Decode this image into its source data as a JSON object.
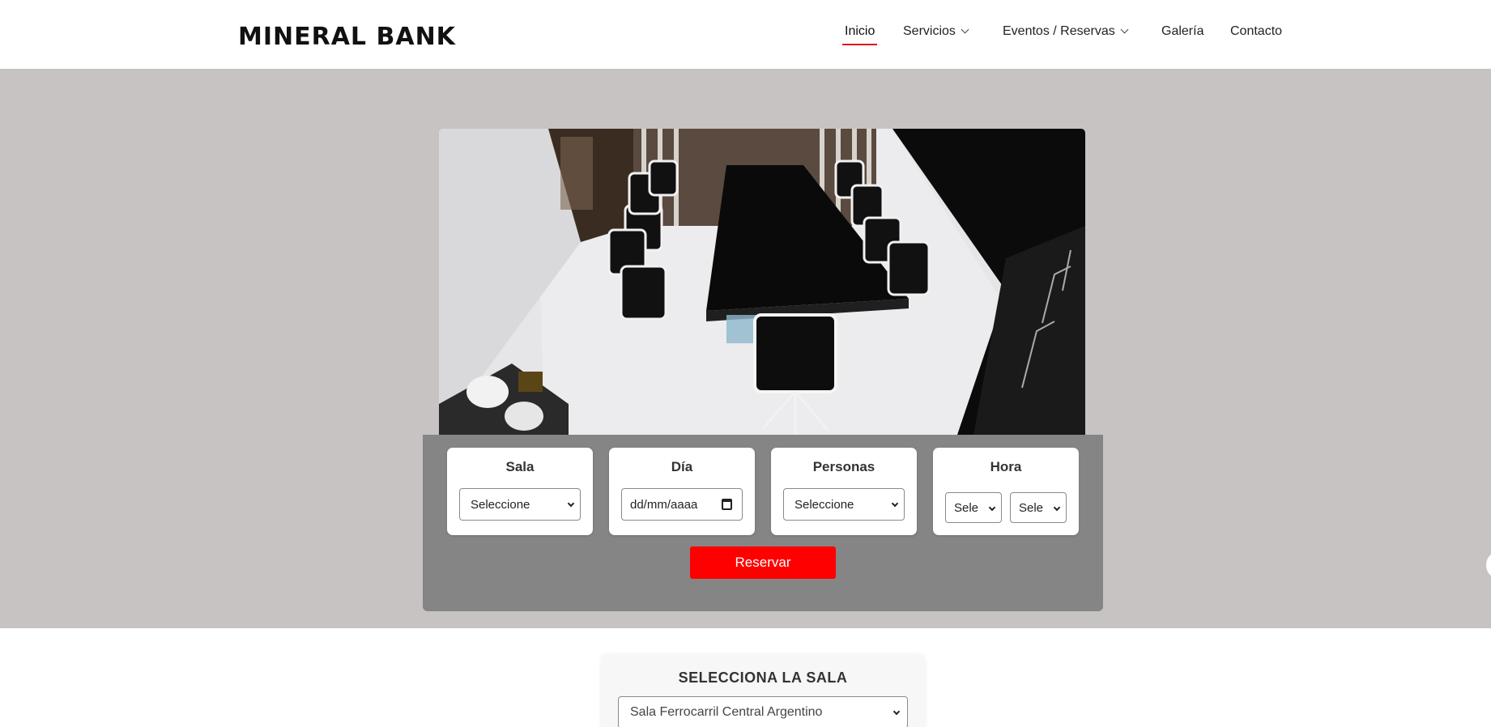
{
  "header": {
    "logo": "MINERAL BANK",
    "nav": {
      "inicio": "Inicio",
      "servicios": "Servicios",
      "eventos": "Eventos / Reservas",
      "galeria": "Galería",
      "contacto": "Contacto"
    },
    "active": "Inicio"
  },
  "booking": {
    "sala_label": "Sala",
    "sala_value": "Seleccione",
    "dia_label": "Día",
    "dia_placeholder": "dd/mm/aaaa",
    "personas_label": "Personas",
    "personas_value": "Seleccione",
    "hora_label": "Hora",
    "hora_value": "Sele",
    "minuto_value": "Sele",
    "reserve_label": "Reservar"
  },
  "sala_section": {
    "title": "SELECCIONA LA SALA",
    "selected": "Sala Ferrocarril Central Argentino"
  },
  "colors": {
    "accent": "#ff0000",
    "hero_bg": "#c7c3c3",
    "booking_bg": "#858585"
  },
  "icons": [
    "chevron-down-icon",
    "calendar-icon"
  ]
}
